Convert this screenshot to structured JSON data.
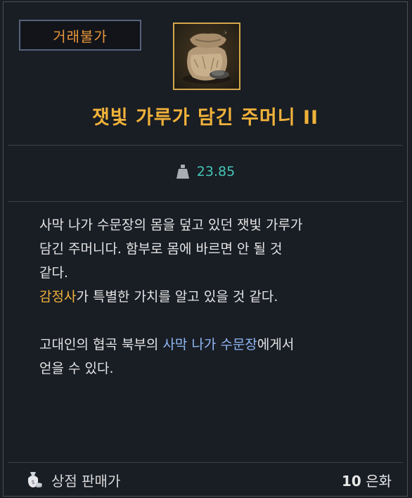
{
  "badge": {
    "label": "거래불가"
  },
  "item": {
    "title": "잿빛 가루가 담긴 주머니 II",
    "icon": "ash-pouch-icon",
    "weight": "23.85"
  },
  "description": {
    "line1": "사막 나가 수문장의 몸을 덮고 있던 잿빛 가루가",
    "line2": "담긴 주머니다. 함부로 몸에 바르면 안 될 것",
    "line3": "같다.",
    "line4_highlight": "감정사",
    "line4_rest": "가 특별한 가치를 알고 있을 것 같다.",
    "line5_prefix": "고대인의 협곡 북부의 ",
    "line5_highlight": "사막 나가 수문장",
    "line5_suffix": "에게서",
    "line6": "얻을 수 있다."
  },
  "footer": {
    "label": "상점 판매가",
    "price_number": "10",
    "price_unit": "은화"
  },
  "colors": {
    "title": "#f0b23a",
    "weight": "#43c7b8",
    "npc_highlight": "#f0b23a",
    "location_highlight": "#8fb8f5",
    "badge_text": "#e8963a"
  }
}
